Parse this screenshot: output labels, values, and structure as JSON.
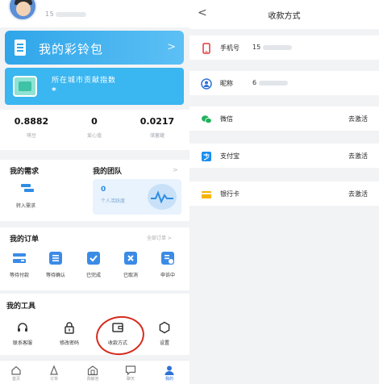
{
  "left": {
    "user_id": "15",
    "wallet": {
      "title": "我的彩铃包",
      "arrow": ">"
    },
    "city": {
      "text": "所在城市贡献指数",
      "value": "*"
    },
    "stats": [
      {
        "value": "0.8882",
        "label": "萌豆"
      },
      {
        "value": "0",
        "label": "爱心值"
      },
      {
        "value": "0.0217",
        "label": "储蓄罐"
      }
    ],
    "needs": {
      "title": "我的需求",
      "team_title": "我的团队",
      "more": ">",
      "transfer_label": "转入需求",
      "team_value": "0",
      "team_label": "个人活跃度"
    },
    "orders": {
      "title": "我的订单",
      "all": "全部订单 >",
      "items": [
        {
          "label": "等待付款",
          "icon": "pending-payment-icon"
        },
        {
          "label": "等待确认",
          "icon": "pending-confirm-icon"
        },
        {
          "label": "已完成",
          "icon": "completed-icon"
        },
        {
          "label": "已取消",
          "icon": "cancelled-icon"
        },
        {
          "label": "申诉中",
          "icon": "appeal-icon"
        }
      ]
    },
    "tools": {
      "title": "我的工具",
      "items": [
        {
          "label": "联系客服",
          "icon": "headset-icon"
        },
        {
          "label": "修改密码",
          "icon": "lock-icon"
        },
        {
          "label": "收款方式",
          "icon": "wallet-icon"
        },
        {
          "label": "设置",
          "icon": "settings-icon"
        }
      ]
    },
    "tabbar": [
      {
        "label": "首页",
        "icon": "home-icon"
      },
      {
        "label": "订单",
        "icon": "order-icon"
      },
      {
        "label": "贡献池",
        "icon": "pool-icon"
      },
      {
        "label": "聊天",
        "icon": "chat-icon"
      },
      {
        "label": "我的",
        "icon": "profile-icon",
        "active": true
      }
    ]
  },
  "right": {
    "title": "收款方式",
    "back": "<",
    "rows": [
      {
        "label": "手机号",
        "value": "15",
        "icon": "phone-icon",
        "color": "#e2383b"
      },
      {
        "label": "昵称",
        "value": "6",
        "icon": "user-circle-icon",
        "color": "#2f72d6"
      },
      {
        "label": "微信",
        "action": "去激活",
        "icon": "wechat-icon",
        "color": "#1fb35a"
      },
      {
        "label": "支付宝",
        "action": "去激活",
        "icon": "alipay-icon",
        "color": "#1a8ef0"
      },
      {
        "label": "银行卡",
        "action": "去激活",
        "icon": "bank-card-icon",
        "color": "#f6b400"
      }
    ]
  },
  "colors": {
    "accent": "#2f8de4",
    "annotation": "#d62b1f"
  }
}
